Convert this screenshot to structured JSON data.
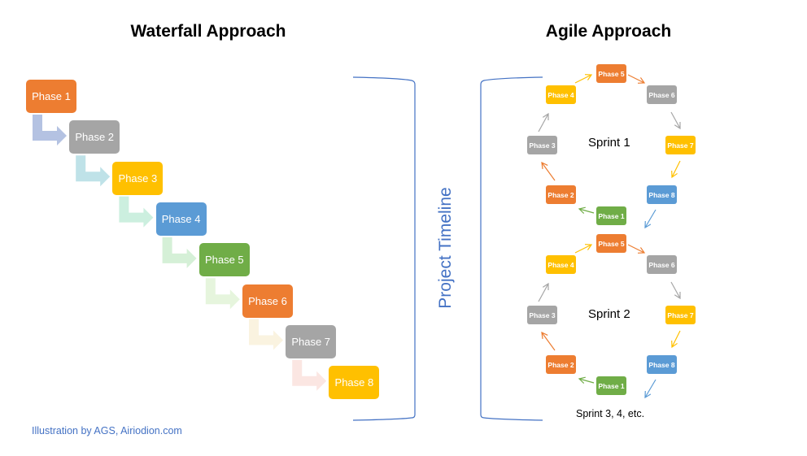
{
  "waterfall": {
    "title": "Waterfall Approach",
    "phases": [
      {
        "label": "Phase 1",
        "color": "#ed7d31",
        "arrow_color": "#b4c2e2"
      },
      {
        "label": "Phase 2",
        "color": "#a5a5a5",
        "arrow_color": "#bfe2e8"
      },
      {
        "label": "Phase 3",
        "color": "#ffc000",
        "arrow_color": "#ccefdf"
      },
      {
        "label": "Phase 4",
        "color": "#5b9bd5",
        "arrow_color": "#d5f0d7"
      },
      {
        "label": "Phase 5",
        "color": "#70ad47",
        "arrow_color": "#e6f5dd"
      },
      {
        "label": "Phase 6",
        "color": "#ed7d31",
        "arrow_color": "#faf3e0"
      },
      {
        "label": "Phase 7",
        "color": "#a5a5a5",
        "arrow_color": "#fbe6e2"
      },
      {
        "label": "Phase 8",
        "color": "#ffc000"
      }
    ]
  },
  "agile": {
    "title": "Agile Approach",
    "sprints": [
      {
        "label": "Sprint 1"
      },
      {
        "label": "Sprint 2"
      }
    ],
    "phases": [
      {
        "label": "Phase 1",
        "color": "#70ad47"
      },
      {
        "label": "Phase 2",
        "color": "#ed7d31"
      },
      {
        "label": "Phase 3",
        "color": "#a5a5a5"
      },
      {
        "label": "Phase 4",
        "color": "#ffc000"
      },
      {
        "label": "Phase 5",
        "color": "#ed7d31"
      },
      {
        "label": "Phase 6",
        "color": "#a5a5a5"
      },
      {
        "label": "Phase 7",
        "color": "#ffc000"
      },
      {
        "label": "Phase 8",
        "color": "#5b9bd5"
      }
    ],
    "more_label": "Sprint 3, 4, etc."
  },
  "timeline_label": "Project Timeline",
  "credit": "Illustration by AGS, Airiodion.com",
  "colors": {
    "bracket": "#4472c4"
  }
}
